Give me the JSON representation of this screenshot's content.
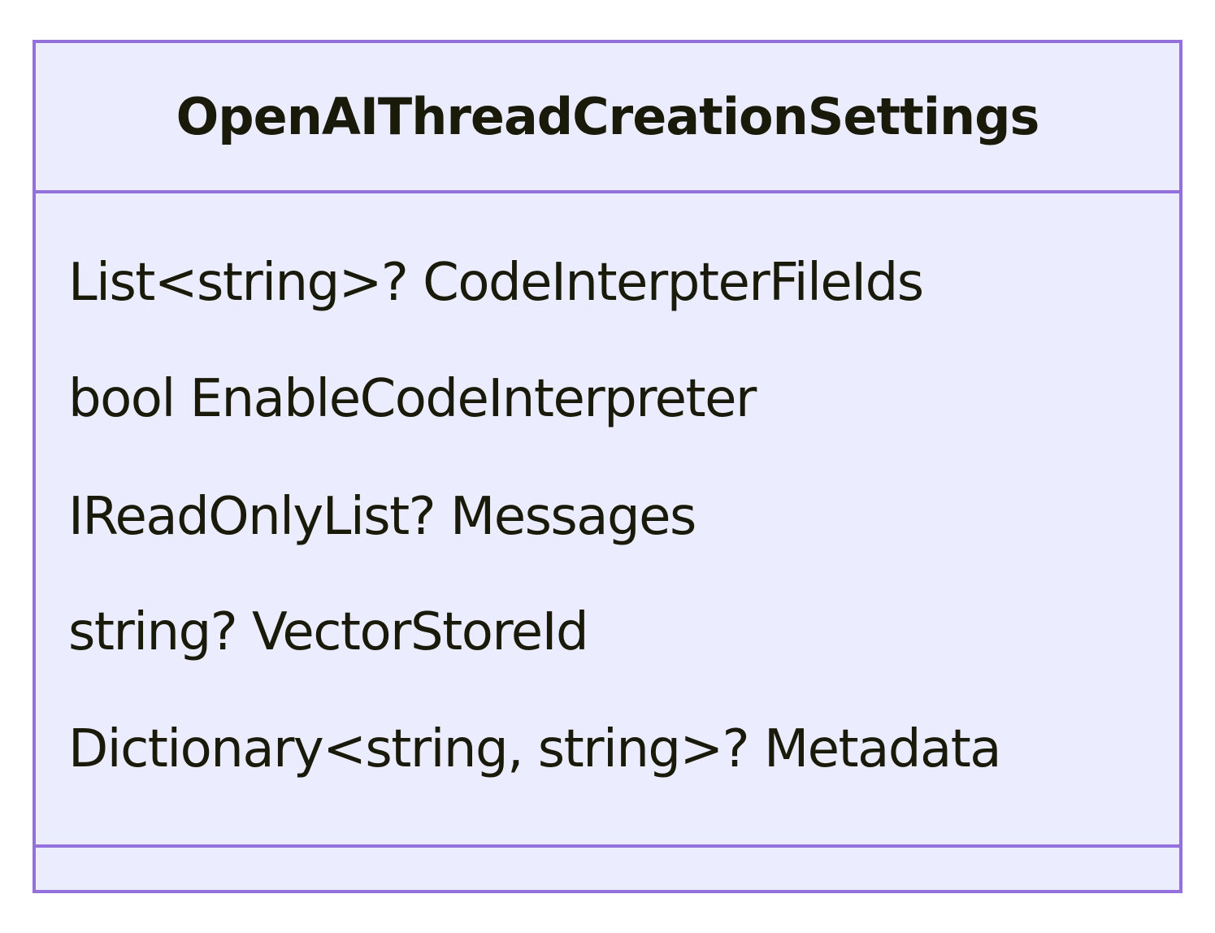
{
  "class": {
    "name": "OpenAIThreadCreationSettings",
    "attributes": [
      "List<string>? CodeInterpterFileIds",
      "bool EnableCodeInterpreter",
      "IReadOnlyList? Messages",
      "string? VectorStoreId",
      "Dictionary<string, string>? Metadata"
    ],
    "methods": []
  },
  "colors": {
    "fill": "#ececff",
    "stroke": "#9370db",
    "text": "#1a1a0a"
  }
}
